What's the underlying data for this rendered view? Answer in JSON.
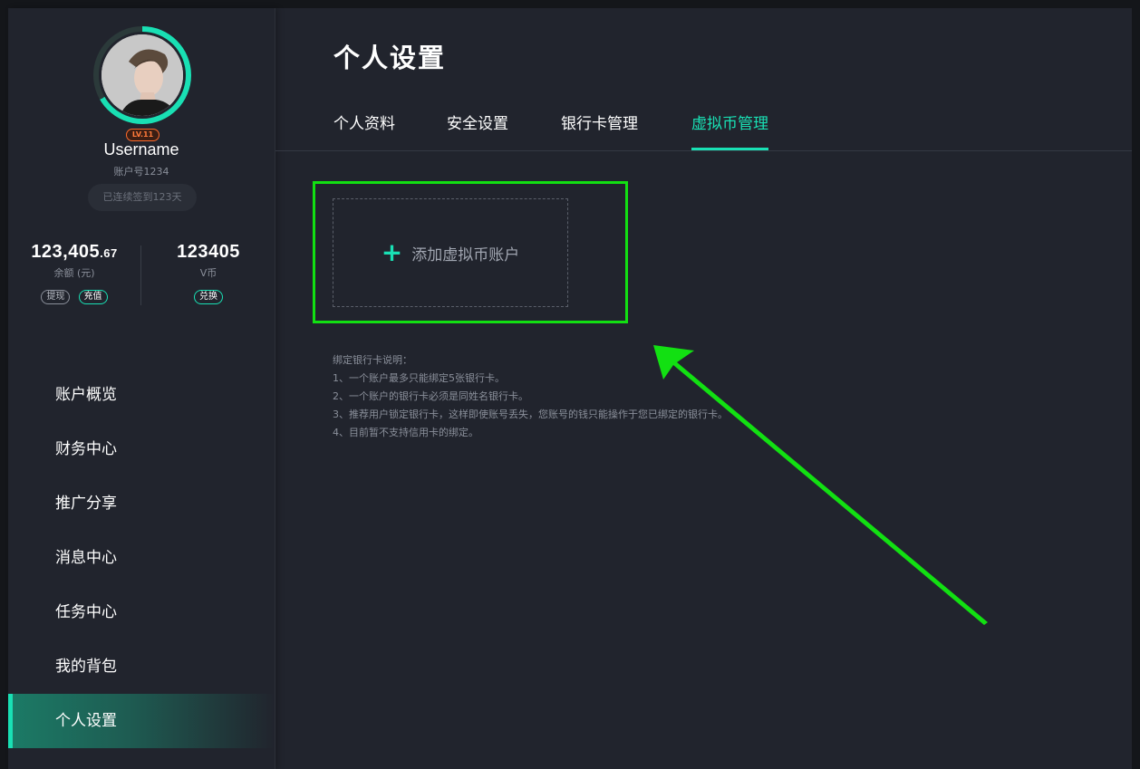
{
  "profile": {
    "level": "LV.11",
    "username": "Username",
    "account_no": "账户号1234",
    "signin_text": "已连续签到123天"
  },
  "balance": {
    "amount_main": "123,405",
    "amount_decimal": ".67",
    "label": "余额 (元)",
    "withdraw_label": "提现",
    "recharge_label": "充值"
  },
  "vcoin": {
    "amount": "123405",
    "label": "V币",
    "exchange_label": "兑换"
  },
  "nav": {
    "items": [
      {
        "label": "账户概览"
      },
      {
        "label": "财务中心"
      },
      {
        "label": "推广分享"
      },
      {
        "label": "消息中心"
      },
      {
        "label": "任务中心"
      },
      {
        "label": "我的背包"
      },
      {
        "label": "个人设置"
      }
    ],
    "active_index": 6
  },
  "main": {
    "title": "个人设置",
    "tabs": [
      {
        "label": "个人资料"
      },
      {
        "label": "安全设置"
      },
      {
        "label": "银行卡管理"
      },
      {
        "label": "虚拟币管理"
      }
    ],
    "active_tab": 3,
    "add_account_label": "添加虚拟币账户",
    "notes": [
      "绑定银行卡说明：",
      "1、一个账户最多只能绑定5张银行卡。",
      "2、一个账户的银行卡必须是同姓名银行卡。",
      "3、推荐用户锁定银行卡，这样即使账号丢失，您账号的钱只能操作于您已绑定的银行卡。",
      "4、目前暂不支持信用卡的绑定。"
    ]
  },
  "colors": {
    "accent": "#19e0b4",
    "annotation_green": "#12e012",
    "level_orange": "#ff6a2a",
    "background": "#21242d"
  },
  "icons": {
    "plus": "plus-icon",
    "avatar": "avatar"
  }
}
